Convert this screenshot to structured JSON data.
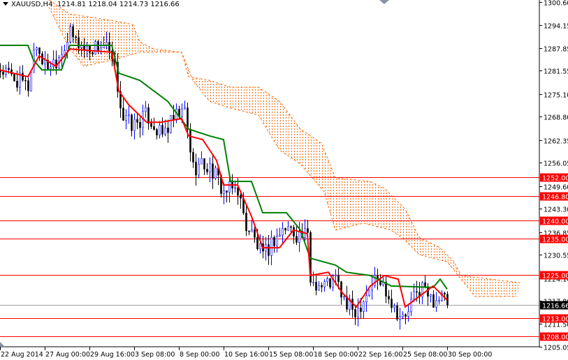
{
  "header": {
    "symbol_tf": "XAUUSD,H4",
    "ohlc": "1214.81 1218.04 1214.73 1216.66"
  },
  "colors": {
    "bull": "#0000ff",
    "bear": "#000000",
    "tenkan": "#ff0000",
    "kijun": "#008000",
    "cloud": "#ff6600",
    "level": "#ff0000",
    "current": "#000000"
  },
  "chart_data": {
    "type": "candlestick",
    "title": "XAUUSD,H4",
    "ylim": [
      1205.05,
      1300.6
    ],
    "xlim_bars": [
      0,
      193
    ],
    "y_ticks": [
      "1300.60",
      "1294.15",
      "1287.85",
      "1281.55",
      "1275.10",
      "1268.80",
      "1262.35",
      "1256.05",
      "1249.60",
      "1243.30",
      "1236.85",
      "1230.55",
      "1224.10",
      "1217.80",
      "1211.50",
      "1205.05"
    ],
    "x_ticks": [
      {
        "bar": 0,
        "label": "22 Aug 2014"
      },
      {
        "bar": 16,
        "label": "27 Aug 00:00"
      },
      {
        "bar": 32,
        "label": "29 Aug 16:00"
      },
      {
        "bar": 48,
        "label": "3 Sep 08:00"
      },
      {
        "bar": 64,
        "label": "8 Sep 00:00"
      },
      {
        "bar": 80,
        "label": "10 Sep 16:00"
      },
      {
        "bar": 96,
        "label": "15 Sep 08:00"
      },
      {
        "bar": 112,
        "label": "18 Sep 00:00"
      },
      {
        "bar": 128,
        "label": "22 Sep 16:00"
      },
      {
        "bar": 144,
        "label": "25 Sep 08:00"
      },
      {
        "bar": 160,
        "label": "30 Sep 00:00"
      }
    ],
    "levels": [
      {
        "price": 1252.0,
        "label": "1252.00"
      },
      {
        "price": 1246.8,
        "label": "1246.80"
      },
      {
        "price": 1240.0,
        "label": "1240.00"
      },
      {
        "price": 1235.0,
        "label": "1235.00"
      },
      {
        "price": 1225.0,
        "label": "1225.00"
      },
      {
        "price": 1213.0,
        "label": "1213.00"
      },
      {
        "price": 1208.0,
        "label": "1208.00"
      }
    ],
    "current_price": {
      "price": 1216.66,
      "label": "1216.66"
    },
    "price_path": [
      [
        0,
        1281.8
      ],
      [
        10,
        1277
      ],
      [
        12.5,
        1289.6
      ],
      [
        16,
        1282.8
      ],
      [
        20,
        1284.7
      ],
      [
        25,
        1291.5
      ],
      [
        30,
        1287.6
      ],
      [
        37.5,
        1288.6
      ],
      [
        41,
        1281.8
      ],
      [
        44,
        1268.3
      ],
      [
        47.5,
        1266.4
      ],
      [
        52.5,
        1269.3
      ],
      [
        57.5,
        1263.5
      ],
      [
        62.5,
        1268.3
      ],
      [
        66,
        1270.2
      ],
      [
        69,
        1254.8
      ],
      [
        72.5,
        1255.7
      ],
      [
        76,
        1253.8
      ],
      [
        80,
        1248
      ],
      [
        85,
        1249
      ],
      [
        87.5,
        1239.3
      ],
      [
        90,
        1236.4
      ],
      [
        94,
        1229.6
      ],
      [
        97.5,
        1234.5
      ],
      [
        102.5,
        1238.3
      ],
      [
        106,
        1236.4
      ],
      [
        110,
        1235.4
      ],
      [
        111,
        1223.8
      ],
      [
        115,
        1221.9
      ],
      [
        120,
        1223.8
      ],
      [
        124,
        1216.1
      ],
      [
        127.5,
        1215.1
      ],
      [
        131,
        1220
      ],
      [
        134,
        1223.8
      ],
      [
        137.5,
        1221.9
      ],
      [
        141,
        1216.1
      ],
      [
        144.5,
        1212.2
      ],
      [
        147.5,
        1218
      ],
      [
        151,
        1221.9
      ],
      [
        154,
        1218
      ],
      [
        157.5,
        1219
      ],
      [
        160,
        1216.66
      ]
    ],
    "tenkan": [
      [
        0,
        1281.8
      ],
      [
        10,
        1279.9
      ],
      [
        14,
        1285.7
      ],
      [
        20,
        1282.8
      ],
      [
        25,
        1287.6
      ],
      [
        40,
        1286.7
      ],
      [
        42.5,
        1276
      ],
      [
        46,
        1272.2
      ],
      [
        52.5,
        1267.3
      ],
      [
        57.5,
        1267.3
      ],
      [
        65,
        1268.3
      ],
      [
        67.5,
        1263.5
      ],
      [
        72.5,
        1262.5
      ],
      [
        77.5,
        1256.7
      ],
      [
        80,
        1249.9
      ],
      [
        85,
        1249.9
      ],
      [
        90,
        1241.2
      ],
      [
        94,
        1232.5
      ],
      [
        100,
        1232.5
      ],
      [
        105,
        1237.4
      ],
      [
        110,
        1236.4
      ],
      [
        111,
        1224.8
      ],
      [
        117.5,
        1225.7
      ],
      [
        122.5,
        1220
      ],
      [
        127.5,
        1216.1
      ],
      [
        132.5,
        1221.9
      ],
      [
        137.5,
        1224.8
      ],
      [
        142.5,
        1223.8
      ],
      [
        145,
        1216.1
      ],
      [
        150,
        1219
      ],
      [
        155,
        1221.9
      ],
      [
        160,
        1218
      ]
    ],
    "kijun": [
      [
        0,
        1288.6
      ],
      [
        10,
        1288.6
      ],
      [
        12,
        1284.5
      ],
      [
        15,
        1281.8
      ],
      [
        22,
        1281.8
      ],
      [
        25,
        1288.6
      ],
      [
        40,
        1288.6
      ],
      [
        42.5,
        1280.9
      ],
      [
        50,
        1278.9
      ],
      [
        60,
        1273.1
      ],
      [
        67.5,
        1265.4
      ],
      [
        75,
        1263.5
      ],
      [
        80,
        1262.5
      ],
      [
        82.5,
        1250.9
      ],
      [
        90,
        1250.9
      ],
      [
        94,
        1242.2
      ],
      [
        102.5,
        1242.2
      ],
      [
        107.5,
        1237.4
      ],
      [
        111,
        1229.6
      ],
      [
        120,
        1227.7
      ],
      [
        124,
        1225.7
      ],
      [
        132.5,
        1224.8
      ],
      [
        140,
        1221.9
      ],
      [
        155,
        1221.5
      ],
      [
        157.5,
        1223.8
      ],
      [
        160,
        1221
      ]
    ],
    "cloud_upper": [
      [
        17.5,
        1301.2
      ],
      [
        25,
        1297.3
      ],
      [
        41,
        1295.4
      ],
      [
        47.5,
        1294.4
      ],
      [
        50,
        1289.6
      ],
      [
        55,
        1287.6
      ],
      [
        65,
        1286.7
      ],
      [
        67.5,
        1279.9
      ],
      [
        75,
        1278.9
      ],
      [
        82.5,
        1277
      ],
      [
        92.5,
        1277
      ],
      [
        100,
        1273.1
      ],
      [
        107.5,
        1265.4
      ],
      [
        115,
        1261.5
      ],
      [
        120,
        1251.9
      ],
      [
        132.5,
        1250.9
      ],
      [
        137.5,
        1249
      ],
      [
        145,
        1243.2
      ],
      [
        150,
        1235.4
      ],
      [
        157.5,
        1232.5
      ],
      [
        162.5,
        1228.6
      ],
      [
        165,
        1224.8
      ],
      [
        186,
        1222.8
      ]
    ],
    "cloud_lower": [
      [
        17.5,
        1299.2
      ],
      [
        25,
        1287.6
      ],
      [
        30,
        1282.8
      ],
      [
        41,
        1284.7
      ],
      [
        50,
        1286.7
      ],
      [
        65,
        1286.7
      ],
      [
        69,
        1278.9
      ],
      [
        75,
        1273.1
      ],
      [
        82.5,
        1271.2
      ],
      [
        92.5,
        1269.3
      ],
      [
        100,
        1259.6
      ],
      [
        107.5,
        1255.7
      ],
      [
        116,
        1248
      ],
      [
        120,
        1237.4
      ],
      [
        130,
        1239.3
      ],
      [
        140,
        1237.4
      ],
      [
        145,
        1234.5
      ],
      [
        150,
        1230.6
      ],
      [
        160,
        1228.6
      ],
      [
        165,
        1223.8
      ],
      [
        170,
        1219
      ],
      [
        185,
        1219
      ]
    ]
  }
}
